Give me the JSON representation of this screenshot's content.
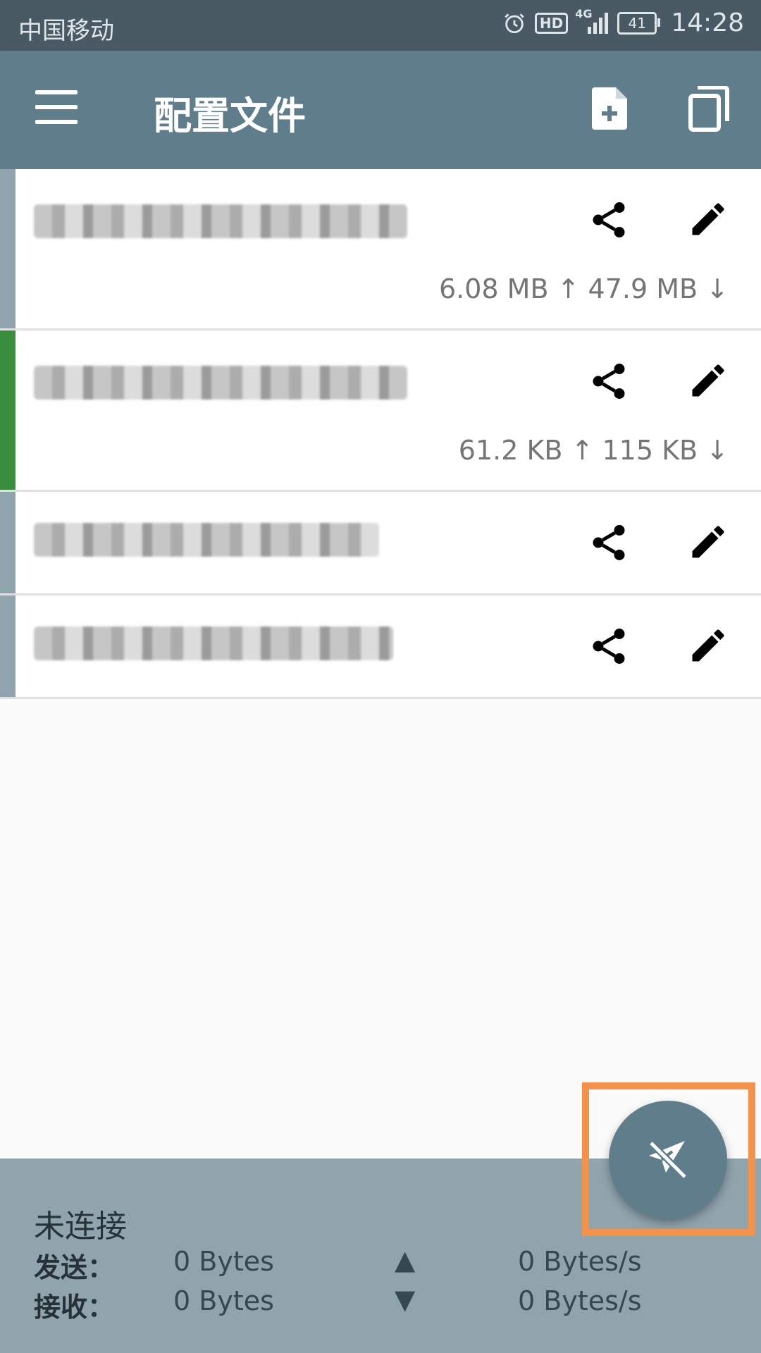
{
  "status_bar": {
    "carrier": "中国移动",
    "network": "4G",
    "hd_badge": "HD",
    "battery": "41",
    "time": "14:28"
  },
  "app_bar": {
    "title": "配置文件",
    "menu_icon": "menu-icon",
    "add_icon": "add-file-icon",
    "copy_icon": "copy-icon"
  },
  "profiles": [
    {
      "traffic": "6.08 MB ↑ 47.9 MB ↓",
      "active": false
    },
    {
      "traffic": "61.2 KB ↑  115 KB ↓",
      "active": true
    },
    {
      "traffic": "",
      "active": false
    },
    {
      "traffic": "",
      "active": false
    }
  ],
  "stats": {
    "state": "未连接",
    "send_label": "发送：",
    "recv_label": "接收：",
    "send_value": "0 Bytes",
    "recv_value": "0 Bytes",
    "up_arrow": "▲",
    "down_arrow": "▼",
    "send_rate": "0 Bytes/s",
    "recv_rate": "0 Bytes/s"
  },
  "fab": {
    "icon": "paper-plane-off-icon"
  },
  "colors": {
    "primary": "#607d8b",
    "active": "#388e3c",
    "highlight": "#f4914a",
    "stats_bg": "#90a4ae"
  }
}
